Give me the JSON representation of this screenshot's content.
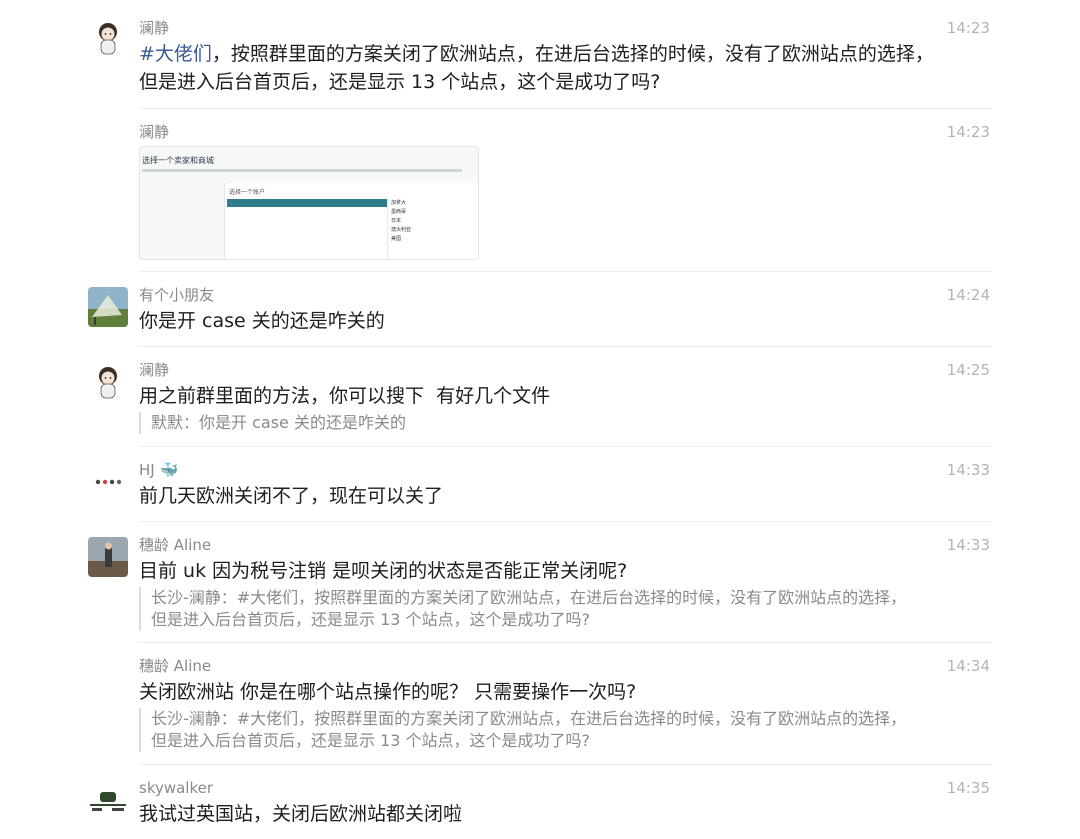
{
  "messages": [
    {
      "sender": "澜静",
      "time": "14:23",
      "tag": "#大佬们",
      "text": "，按照群里面的方案关闭了欧洲站点，在进后台选择的时候，没有了欧洲站点的选择，\n但是进入后台首页后，还是显示 13 个站点，这个是成功了吗?"
    },
    {
      "sender": "澜静",
      "time": "14:23",
      "image": {
        "title": "选择一个卖家和商城",
        "account_label": "选择一个账户",
        "countries": [
          "加拿大",
          "墨西哥",
          "日本",
          "澳大利亚",
          "美国"
        ]
      }
    },
    {
      "sender": "有个小朋友",
      "time": "14:24",
      "text": "你是开 case 关的还是咋关的"
    },
    {
      "sender": "澜静",
      "time": "14:25",
      "text": "用之前群里面的方法，你可以搜下  有好几个文件",
      "quote": "默默：你是开 case 关的还是咋关的"
    },
    {
      "sender": "HJ 🐳",
      "time": "14:33",
      "text": "前几天欧洲关闭不了，现在可以关了"
    },
    {
      "sender": "穗龄 Aline",
      "time": "14:33",
      "text": "目前 uk 因为税号注销 是呗关闭的状态是否能正常关闭呢?",
      "quote": "长沙-澜静：#大佬们，按照群里面的方案关闭了欧洲站点，在进后台选择的时候，没有了欧洲站点的选择，\n但是进入后台首页后，还是显示 13 个站点，这个是成功了吗?"
    },
    {
      "sender": "穗龄 Aline",
      "time": "14:34",
      "text": "关闭欧洲站 你是在哪个站点操作的呢？ 只需要操作一次吗?",
      "quote": "长沙-澜静：#大佬们，按照群里面的方案关闭了欧洲站点，在进后台选择的时候，没有了欧洲站点的选择，\n但是进入后台首页后，还是显示 13 个站点，这个是成功了吗?"
    },
    {
      "sender": "skywalker",
      "time": "14:35",
      "text": "我试过英国站，关闭后欧洲站都关闭啦"
    }
  ]
}
